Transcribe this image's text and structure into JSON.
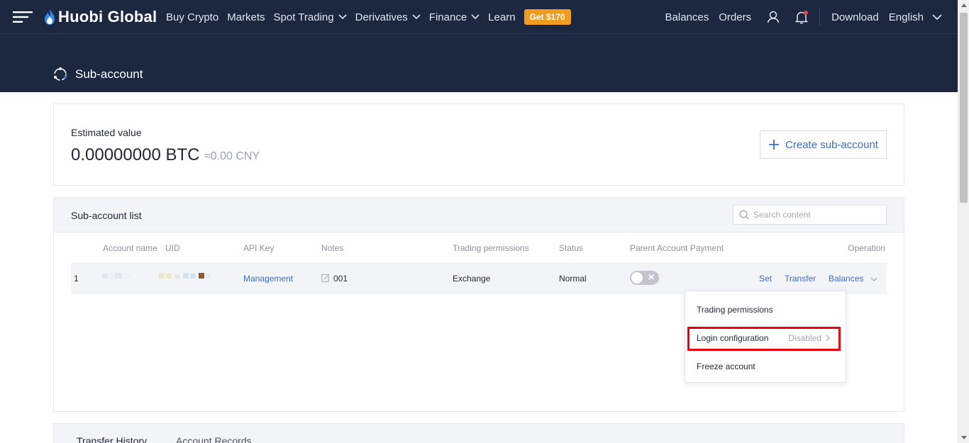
{
  "nav": {
    "logo_text": "Huobi Global",
    "items": [
      {
        "label": "Buy Crypto",
        "has_dropdown": false
      },
      {
        "label": "Markets",
        "has_dropdown": false
      },
      {
        "label": "Spot Trading",
        "has_dropdown": true
      },
      {
        "label": "Derivatives",
        "has_dropdown": true
      },
      {
        "label": "Finance",
        "has_dropdown": true
      },
      {
        "label": "Learn",
        "has_dropdown": false
      }
    ],
    "promo_label": "Get $170",
    "right": {
      "balances": "Balances",
      "orders": "Orders",
      "download": "Download",
      "language": "English"
    }
  },
  "banner": {
    "title": "Sub-account"
  },
  "estimated": {
    "label": "Estimated value",
    "value": "0.00000000 BTC",
    "cny": "≈0.00 CNY",
    "create_button": "Create sub-account"
  },
  "list": {
    "title": "Sub-account list",
    "search_placeholder": "Search content",
    "columns": {
      "account_name": "Account name",
      "uid": "UID",
      "api_key": "API Key",
      "notes": "Notes",
      "trading_permissions": "Trading permissions",
      "status": "Status",
      "parent_payment": "Parent Account Payment",
      "operation": "Operation"
    },
    "rows": [
      {
        "index": "1",
        "api_key": "Management",
        "notes": "001",
        "trading_permissions": "Exchange",
        "status": "Normal",
        "parent_payment_enabled": false,
        "ops": {
          "set": "Set",
          "transfer": "Transfer",
          "balances": "Balances"
        }
      }
    ]
  },
  "dropdown": {
    "trading_permissions": "Trading permissions",
    "login_configuration": "Login configuration",
    "login_status": "Disabled",
    "freeze_account": "Freeze account"
  },
  "history": {
    "tabs": [
      "Transfer History",
      "Account Records"
    ]
  },
  "colors": {
    "nav_bg": "#1b2840",
    "link": "#3a6cd1",
    "promo": "#f29c1f",
    "highlight": "#e8000e"
  }
}
